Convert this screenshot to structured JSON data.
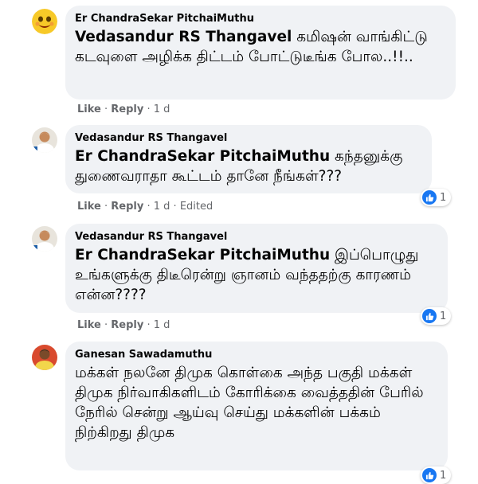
{
  "comments": [
    {
      "author": "Er ChandraSekar PitchaiMuthu",
      "mention": "Vedasandur RS Thangavel",
      "text": " கமிஷன் வாங்கிட்டு கடவுளை அழிக்க திட்டம் போட்டுடீங்க போல..!!..",
      "like_label": "Like",
      "reply_label": "Reply",
      "time": "1 d",
      "avatar_icon": "emoji-avatar-icon"
    },
    {
      "author": "Vedasandur RS Thangavel",
      "mention": "Er ChandraSekar PitchaiMuthu",
      "text": " கந்தனுக்கு துணைவராதா கூட்டம் தானே நீங்கள்???",
      "like_label": "Like",
      "reply_label": "Reply",
      "time": "1 d",
      "edited_label": "Edited",
      "reaction_count": "1",
      "avatar_icon": "person-avatar-icon"
    },
    {
      "author": "Vedasandur RS Thangavel",
      "mention": "Er ChandraSekar PitchaiMuthu",
      "text": " இப்பொழுது உங்களுக்கு திடீரென்று ஞானம் வந்ததற்கு காரணம் என்ன????",
      "like_label": "Like",
      "reply_label": "Reply",
      "time": "1 d",
      "reaction_count": "1",
      "avatar_icon": "person-avatar-icon"
    },
    {
      "author": "Ganesan Sawadamuthu",
      "text": "மக்கள் நலனே திமுக கொள்கை அந்த பகுதி மக்கள் திமுக நிர்வாகிகளிடம் கோரிக்கை வைத்ததின் பேரில் நேரில் சென்று ஆய்வு செய்து மக்களின் பக்கம் நிற்கிறது திமுக",
      "reaction_count": "1",
      "avatar_icon": "person-avatar-icon"
    }
  ],
  "colors": {
    "bubble": "#f0f2f5",
    "secondary_text": "#65676b",
    "like_blue": "#1877f2"
  }
}
